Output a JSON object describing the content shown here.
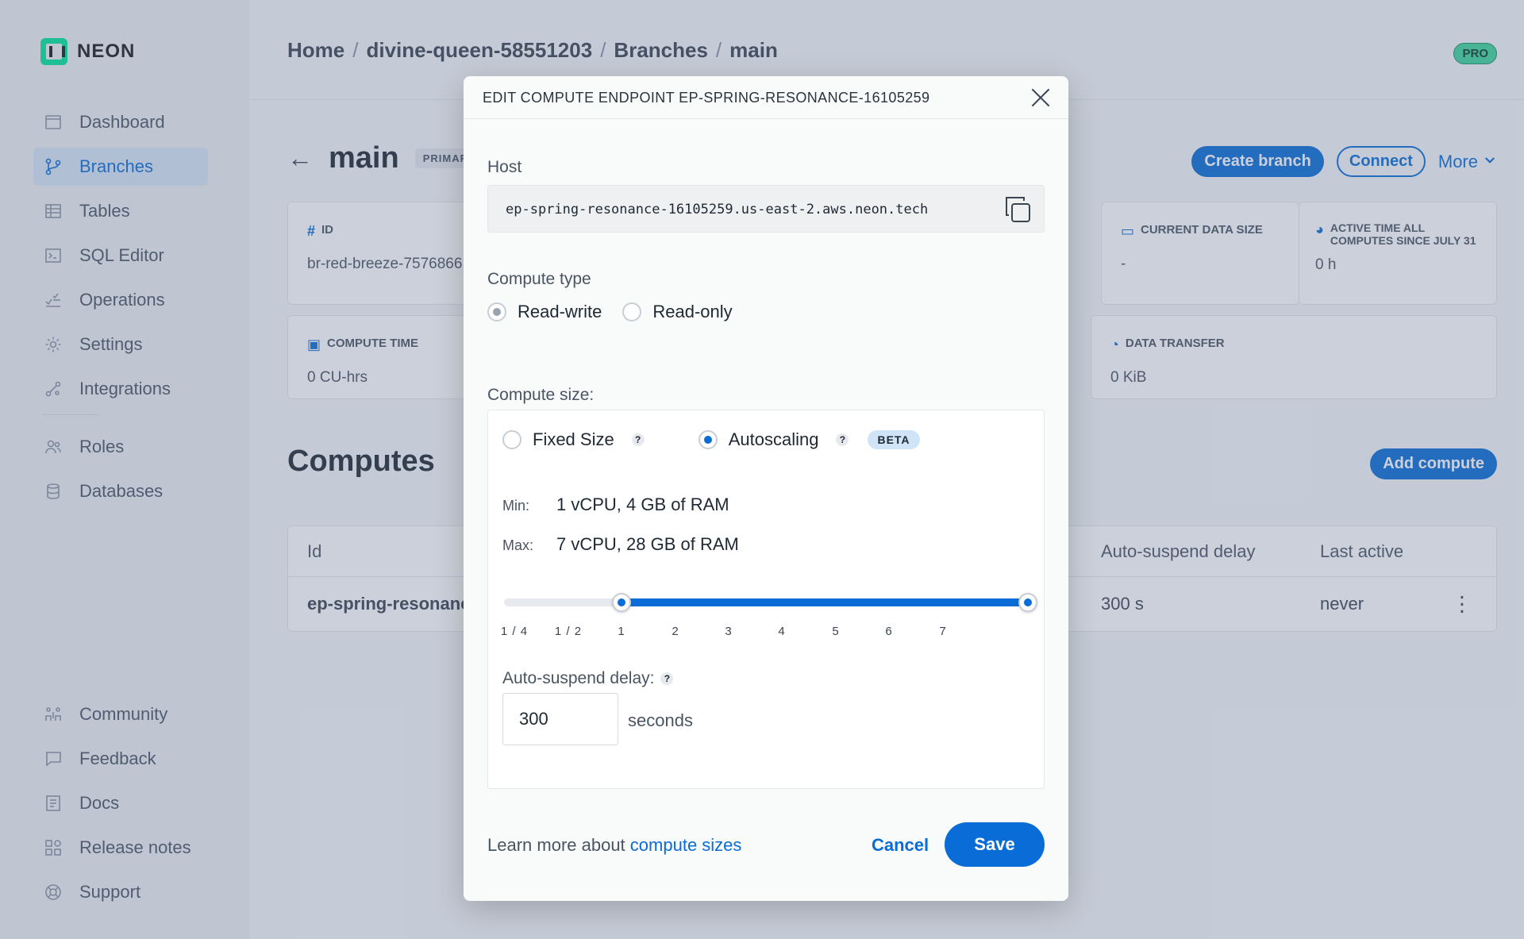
{
  "brand": {
    "name": "NEON"
  },
  "sidebar": {
    "items": [
      {
        "label": "Dashboard",
        "icon": "dashboard-icon"
      },
      {
        "label": "Branches",
        "icon": "branch-icon",
        "active": true
      },
      {
        "label": "Tables",
        "icon": "table-icon"
      },
      {
        "label": "SQL Editor",
        "icon": "sql-editor-icon"
      },
      {
        "label": "Operations",
        "icon": "operations-icon"
      },
      {
        "label": "Settings",
        "icon": "gear-icon"
      },
      {
        "label": "Integrations",
        "icon": "integrations-icon"
      },
      {
        "label": "Roles",
        "icon": "users-icon"
      },
      {
        "label": "Databases",
        "icon": "database-icon"
      }
    ],
    "bottom_items": [
      {
        "label": "Community",
        "icon": "community-icon"
      },
      {
        "label": "Feedback",
        "icon": "chat-icon"
      },
      {
        "label": "Docs",
        "icon": "docs-icon"
      },
      {
        "label": "Release notes",
        "icon": "release-notes-icon"
      },
      {
        "label": "Support",
        "icon": "support-icon"
      }
    ]
  },
  "header": {
    "breadcrumb": [
      "Home",
      "divine-queen-58551203",
      "Branches",
      "main"
    ],
    "plan_badge": "PRO"
  },
  "branch": {
    "title": "main",
    "badge": "PRIMAR",
    "actions": {
      "create": "Create branch",
      "connect": "Connect",
      "more": "More"
    },
    "stats": {
      "id_label": "ID",
      "id_value": "br-red-breeze-7576866",
      "data_size_label": "CURRENT DATA SIZE",
      "data_size_value": "-",
      "active_time_label": "ACTIVE TIME ALL COMPUTES SINCE JULY 31",
      "active_time_value": "0 h",
      "compute_time_label": "COMPUTE TIME",
      "compute_time_value": "0 CU-hrs",
      "transfer_label": "DATA TRANSFER",
      "transfer_value": "0 KiB"
    }
  },
  "computes": {
    "title": "Computes",
    "add_label": "Add compute",
    "columns": {
      "id": "Id",
      "suspend": "Auto-suspend delay",
      "last_active": "Last active"
    },
    "rows": [
      {
        "id": "ep-spring-resonanc",
        "suspend": "300 s",
        "last_active": "never"
      }
    ]
  },
  "modal": {
    "title": "EDIT COMPUTE ENDPOINT EP-SPRING-RESONANCE-16105259",
    "host_label": "Host",
    "host_value": "ep-spring-resonance-16105259.us-east-2.aws.neon.tech",
    "compute_type_label": "Compute type",
    "compute_types": {
      "read_write": "Read-write",
      "read_only": "Read-only",
      "selected": "read_write"
    },
    "compute_size_label": "Compute size:",
    "size_modes": {
      "fixed": "Fixed Size",
      "autoscaling": "Autoscaling",
      "beta": "BETA",
      "selected": "autoscaling",
      "help": "?"
    },
    "min_label": "Min:",
    "min_value": "1 vCPU, 4 GB of RAM",
    "max_label": "Max:",
    "max_value": "7 vCPU, 28 GB of RAM",
    "slider": {
      "ticks": [
        "1 / 4",
        "1 / 2",
        "1",
        "2",
        "3",
        "4",
        "5",
        "6",
        "7"
      ],
      "min_index": 2,
      "max_index": 8
    },
    "suspend_label": "Auto-suspend delay:",
    "suspend_value": "300",
    "suspend_unit": "seconds",
    "learn_prefix": "Learn more about",
    "learn_link": "compute sizes",
    "cancel_label": "Cancel",
    "save_label": "Save"
  }
}
